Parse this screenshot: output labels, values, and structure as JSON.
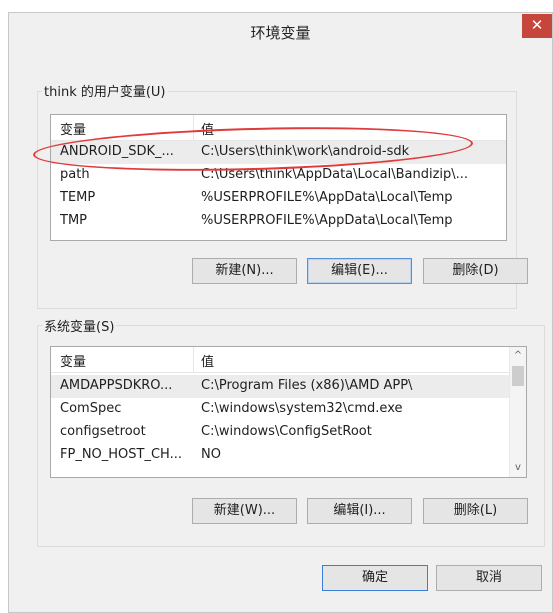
{
  "window": {
    "title": "环境变量",
    "close_glyph": "✕"
  },
  "user_group": {
    "label": "think 的用户变量(U)",
    "columns": [
      "变量",
      "值"
    ],
    "rows": [
      {
        "name": "ANDROID_SDK_...",
        "value": "C:\\Users\\think\\work\\android-sdk"
      },
      {
        "name": "path",
        "value": "C:\\Users\\think\\AppData\\Local\\Bandizip\\..."
      },
      {
        "name": "TEMP",
        "value": "%USERPROFILE%\\AppData\\Local\\Temp"
      },
      {
        "name": "TMP",
        "value": "%USERPROFILE%\\AppData\\Local\\Temp"
      }
    ],
    "buttons": {
      "new": "新建(N)...",
      "edit": "编辑(E)...",
      "delete": "删除(D)"
    }
  },
  "system_group": {
    "label": "系统变量(S)",
    "columns": [
      "变量",
      "值"
    ],
    "rows": [
      {
        "name": "AMDAPPSDKRO...",
        "value": "C:\\Program Files (x86)\\AMD APP\\"
      },
      {
        "name": "ComSpec",
        "value": "C:\\windows\\system32\\cmd.exe"
      },
      {
        "name": "configsetroot",
        "value": "C:\\windows\\ConfigSetRoot"
      },
      {
        "name": "FP_NO_HOST_CH...",
        "value": "NO"
      }
    ],
    "buttons": {
      "new": "新建(W)...",
      "edit": "编辑(I)...",
      "delete": "删除(L)"
    },
    "scroll_up_glyph": "^",
    "scroll_down_glyph": "v"
  },
  "footer": {
    "ok": "确定",
    "cancel": "取消"
  },
  "colors": {
    "close_bg": "#c7463c",
    "annotation": "#e03a3a",
    "default_button_border": "#3c7fd8"
  }
}
